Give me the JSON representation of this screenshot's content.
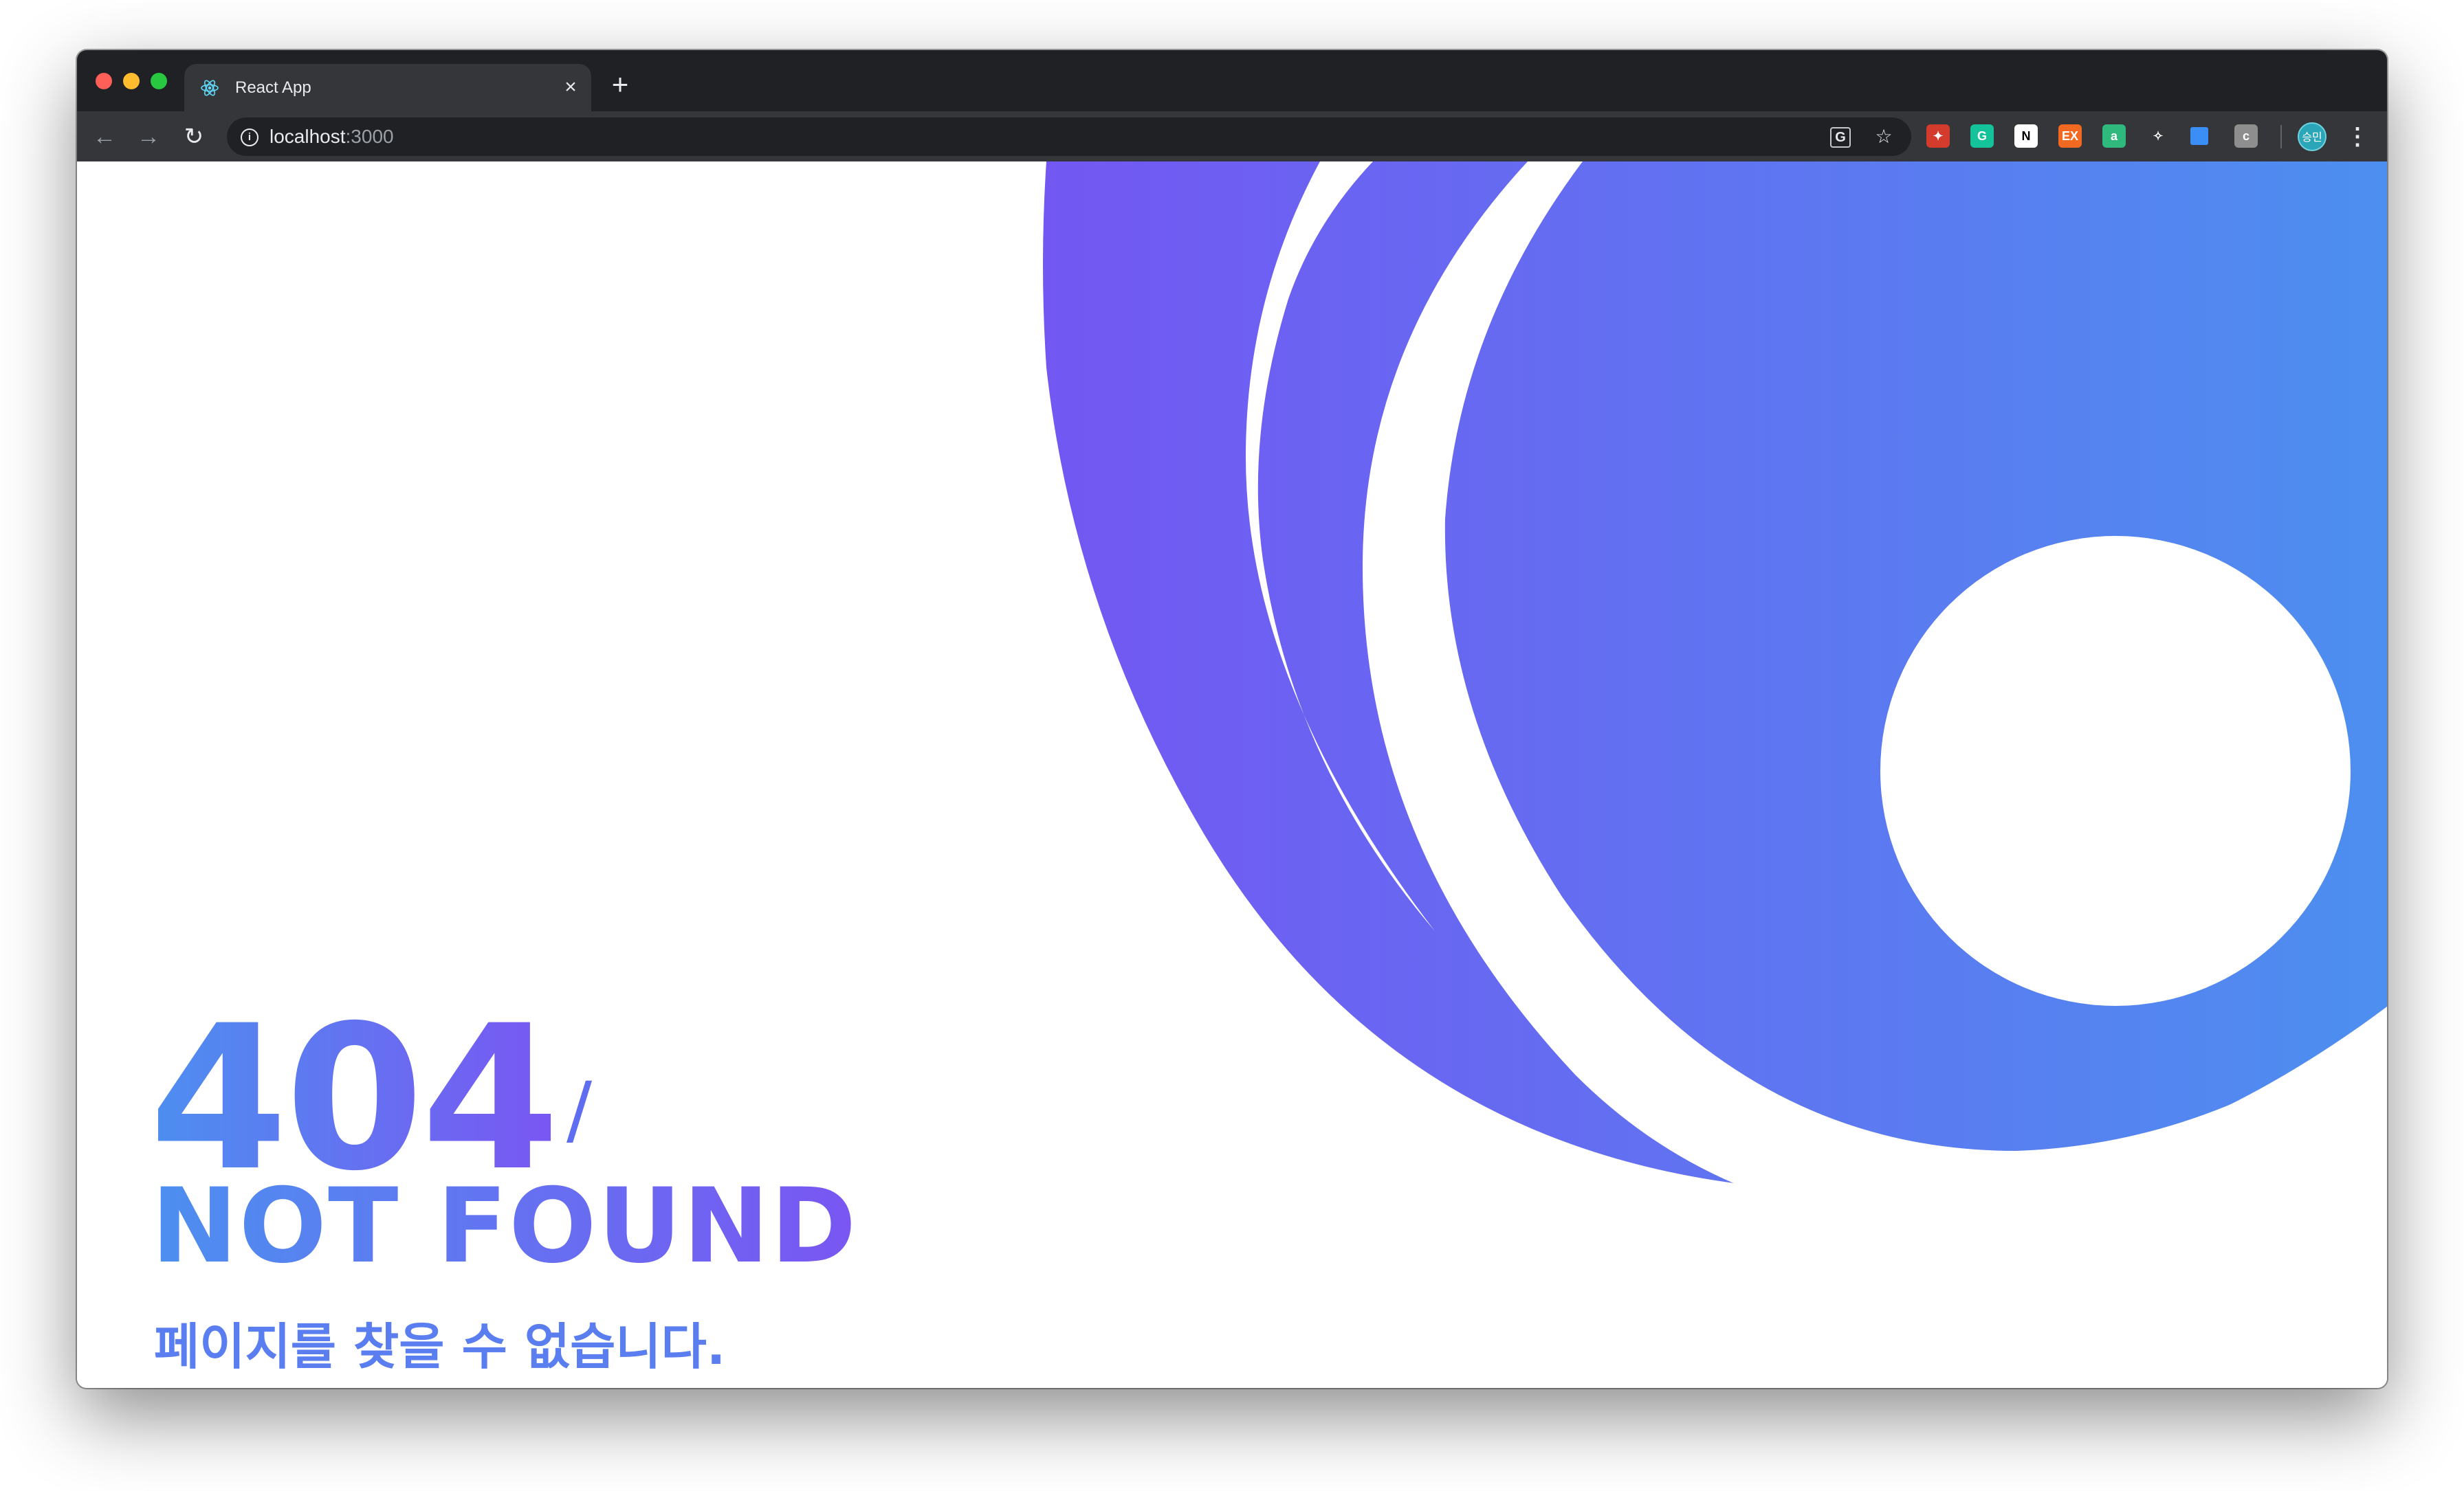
{
  "browser": {
    "tab": {
      "title": "React App",
      "favicon": "react-atom-icon",
      "close_label": "×"
    },
    "new_tab_label": "+",
    "toolbar": {
      "back_icon": "←",
      "forward_icon": "→",
      "reload_icon": "↻",
      "url_host": "localhost",
      "url_port": ":3000",
      "info_icon": "i",
      "translate_icon": "G",
      "star_icon": "☆",
      "menu_icon": "⋮"
    },
    "extensions": [
      {
        "name": "ext-red-icon",
        "glyph": "✦",
        "color": "#d33b2c"
      },
      {
        "name": "grammarly-icon",
        "glyph": "G",
        "color": "#15c39a"
      },
      {
        "name": "notion-icon",
        "glyph": "N",
        "color": "#ffffff"
      },
      {
        "name": "ex-icon",
        "glyph": "EX",
        "color": "#f26a21"
      },
      {
        "name": "a-icon",
        "glyph": "a",
        "color": "#2fb97d"
      },
      {
        "name": "ext-sparkle-icon",
        "glyph": "✧",
        "color": "#35363a"
      },
      {
        "name": "ext-blue-square-icon",
        "glyph": "",
        "color": "#3a8ef6"
      },
      {
        "name": "c-icon",
        "glyph": "c",
        "color": "#8e8e8e"
      }
    ],
    "avatar_label": "승민"
  },
  "page": {
    "code": "404",
    "slash": "/",
    "headline": "NOT FOUND",
    "message": "페이지를 찾을 수 없습니다."
  },
  "colors": {
    "gradient_start": "#7357f2",
    "gradient_end": "#4d8ff0"
  }
}
